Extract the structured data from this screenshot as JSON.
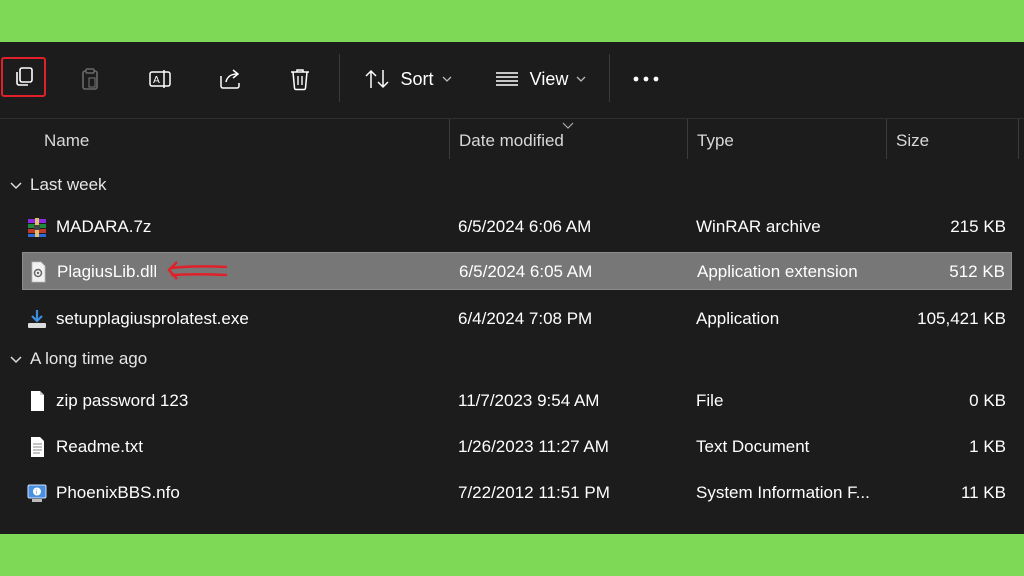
{
  "toolbar": {
    "sort_label": "Sort",
    "view_label": "View",
    "buttons": [
      "copy-icon",
      "paste-icon",
      "rename-icon",
      "share-icon",
      "delete-icon"
    ]
  },
  "columns": {
    "name": "Name",
    "date": "Date modified",
    "type": "Type",
    "size": "Size"
  },
  "groups": [
    {
      "label": "Last week",
      "files": [
        {
          "name": "MADARA.7z",
          "date": "6/5/2024 6:06 AM",
          "type": "WinRAR archive",
          "size": "215 KB",
          "icon": "winrar-archive-icon"
        },
        {
          "name": "PlagiusLib.dll",
          "date": "6/5/2024 6:05 AM",
          "type": "Application extension",
          "size": "512 KB",
          "icon": "dll-file-icon"
        },
        {
          "name": "setupplagiusprolatest.exe",
          "date": "6/4/2024 7:08 PM",
          "type": "Application",
          "size": "105,421 KB",
          "icon": "installer-icon"
        }
      ]
    },
    {
      "label": "A long time ago",
      "files": [
        {
          "name": "zip password 123",
          "date": "11/7/2023 9:54 AM",
          "type": "File",
          "size": "0 KB",
          "icon": "blank-file-icon"
        },
        {
          "name": "Readme.txt",
          "date": "1/26/2023 11:27 AM",
          "type": "Text Document",
          "size": "1 KB",
          "icon": "text-file-icon"
        },
        {
          "name": "PhoenixBBS.nfo",
          "date": "7/22/2012 11:51 PM",
          "type": "System Information F...",
          "size": "11 KB",
          "icon": "system-info-icon"
        }
      ]
    }
  ],
  "colors": {
    "background": "#7ed957",
    "window": "#1c1c1c",
    "selected_row": "#777777",
    "annotation_red": "#e0202a"
  }
}
